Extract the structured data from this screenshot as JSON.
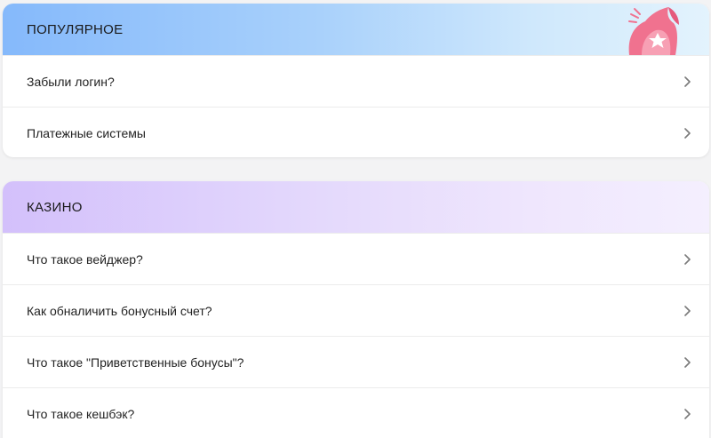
{
  "sections": [
    {
      "title": "ПОПУЛЯРНОЕ",
      "items": [
        {
          "label": "Забыли логин?"
        },
        {
          "label": "Платежные системы"
        }
      ]
    },
    {
      "title": "КАЗИНО",
      "items": [
        {
          "label": "Что такое вейджер?"
        },
        {
          "label": "Как обналичить бонусный счет?"
        },
        {
          "label": "Что такое \"Приветственные бонусы\"?"
        },
        {
          "label": "Что такое кешбэк?"
        }
      ]
    }
  ],
  "icons": {
    "row_chevron": "chevron-right-icon",
    "mascot": "star-mascot-icon"
  },
  "colors": {
    "popular_header_start": "#85b9fb",
    "casino_header_start": "#d3c0fb",
    "mascot_pink": "#f0728f"
  }
}
